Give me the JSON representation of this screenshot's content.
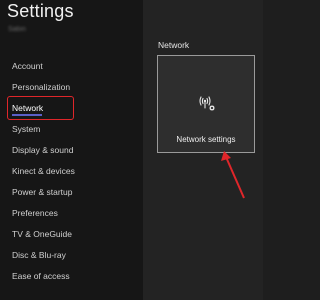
{
  "app": {
    "title": "Settings",
    "account": "Sabin"
  },
  "sidebar": {
    "items": [
      {
        "label": "Account"
      },
      {
        "label": "Personalization"
      },
      {
        "label": "Network",
        "selected": true
      },
      {
        "label": "System"
      },
      {
        "label": "Display & sound"
      },
      {
        "label": "Kinect & devices"
      },
      {
        "label": "Power & startup"
      },
      {
        "label": "Preferences"
      },
      {
        "label": "TV & OneGuide"
      },
      {
        "label": "Disc & Blu-ray"
      },
      {
        "label": "Ease of access"
      }
    ]
  },
  "main": {
    "section_title": "Network",
    "tile": {
      "label": "Network settings",
      "icon": "network-settings-icon"
    }
  },
  "annotations": {
    "highlight_color": "#e0262a",
    "arrow_color": "#e0262a"
  },
  "colors": {
    "background": "#1e1e1e",
    "sidebar": "#161616",
    "tile": "#2e2e2e",
    "accent": "#5b5fc7"
  }
}
